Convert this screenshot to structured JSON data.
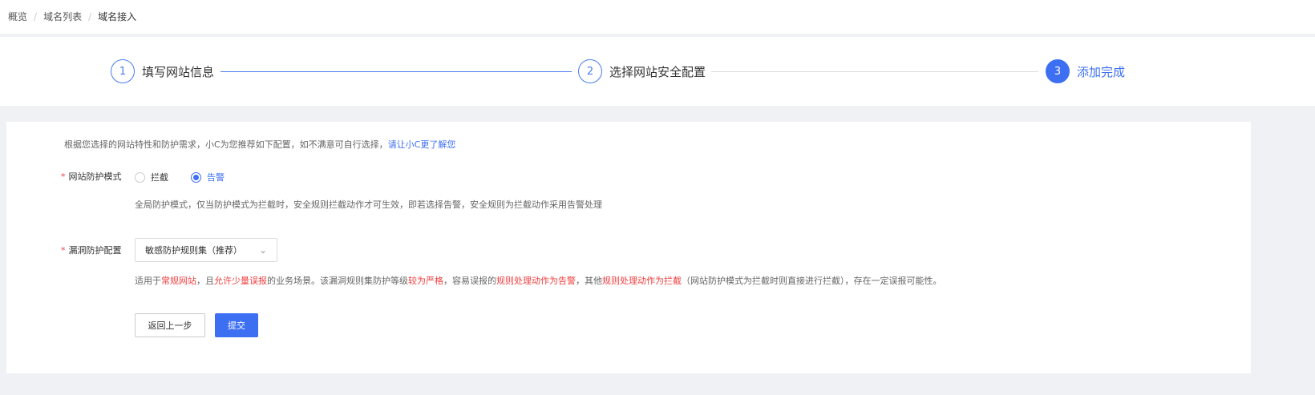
{
  "breadcrumb": [
    "概览",
    "域名列表",
    "域名接入"
  ],
  "steps": [
    {
      "num": "1",
      "label": "填写网站信息"
    },
    {
      "num": "2",
      "label": "选择网站安全配置"
    },
    {
      "num": "3",
      "label": "添加完成"
    }
  ],
  "note": {
    "text": "根据您选择的网站特性和防护需求，小C为您推荐如下配置，如不满意可自行选择，",
    "link": "请让小C更了解您"
  },
  "mode": {
    "label": "网站防护模式",
    "options": [
      "拦截",
      "告警"
    ],
    "selected": "告警",
    "desc": "全局防护模式，仅当防护模式为拦截时，安全规则拦截动作才可生效，即若选择告警，安全规则为拦截动作采用告警处理"
  },
  "vuln": {
    "label": "漏洞防护配置",
    "value": "敏感防护规则集（推荐）",
    "desc": [
      "适用于",
      "常规网站",
      "，且",
      "允许少量误报",
      "的业务场景。该漏洞规则集防护等级",
      "较为严格",
      "，容易误报的",
      "规则处理动作为告警",
      "，其他",
      "规则处理动作为拦截",
      "（网站防护模式为拦截时则直接进行拦截），存在一定误报可能性。"
    ]
  },
  "buttons": {
    "back": "返回上一步",
    "submit": "提交"
  },
  "colors": {
    "primary": "#3d6ff2",
    "danger": "#f03e3e"
  }
}
